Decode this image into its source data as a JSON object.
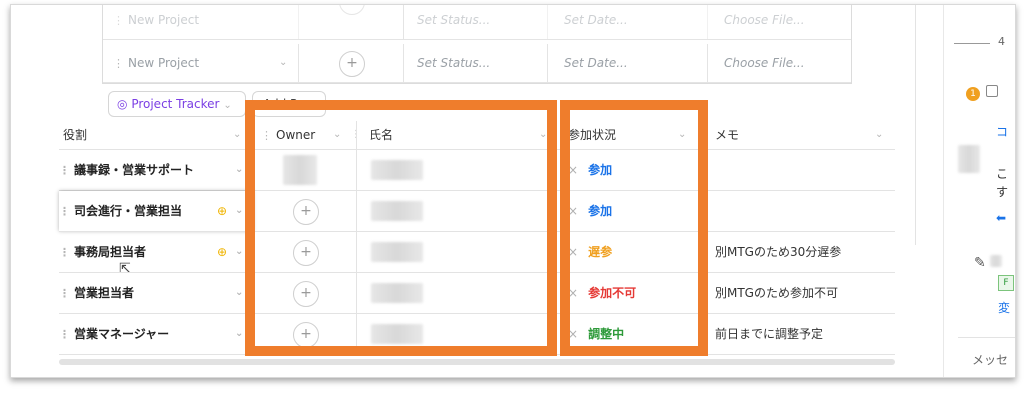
{
  "top_table": {
    "rows": [
      {
        "name": "New Project",
        "status": "Set Status...",
        "date": "Set Date...",
        "file": "Choose File..."
      },
      {
        "name": "New Project",
        "status": "Set Status...",
        "date": "Set Date...",
        "file": "Choose File..."
      }
    ]
  },
  "toolbar": {
    "project_tracker": "Project Tracker",
    "add_label": "Add P"
  },
  "headers": {
    "role": "役割",
    "owner": "Owner",
    "name": "氏名",
    "attendance": "参加状況",
    "memo": "メモ"
  },
  "rows": [
    {
      "role": "議事録・営業サポート",
      "status": "参加",
      "status_color": "#1a73e8",
      "memo": ""
    },
    {
      "role": "司会進行・営業担当",
      "status": "参加",
      "status_color": "#1a73e8",
      "memo": ""
    },
    {
      "role": "事務局担当者",
      "status": "遅参",
      "status_color": "#f0a020",
      "memo": "別MTGのため30分遅参"
    },
    {
      "role": "営業担当者",
      "status": "参加不可",
      "status_color": "#e53935",
      "memo": "別MTGのため参加不可"
    },
    {
      "role": "営業マネージャー",
      "status": "調整中",
      "status_color": "#2e9a3a",
      "memo": "前日までに調整予定"
    }
  ],
  "side_panel": {
    "top_text": "4",
    "badge_count": "1",
    "link_text": "コ",
    "text1": "こ",
    "text2": "す",
    "tag_text": "F",
    "link2": "変",
    "message_label": "メッセ"
  },
  "colors": {
    "highlight": "#ef7d2c",
    "accent_purple": "#7b3fe4"
  }
}
